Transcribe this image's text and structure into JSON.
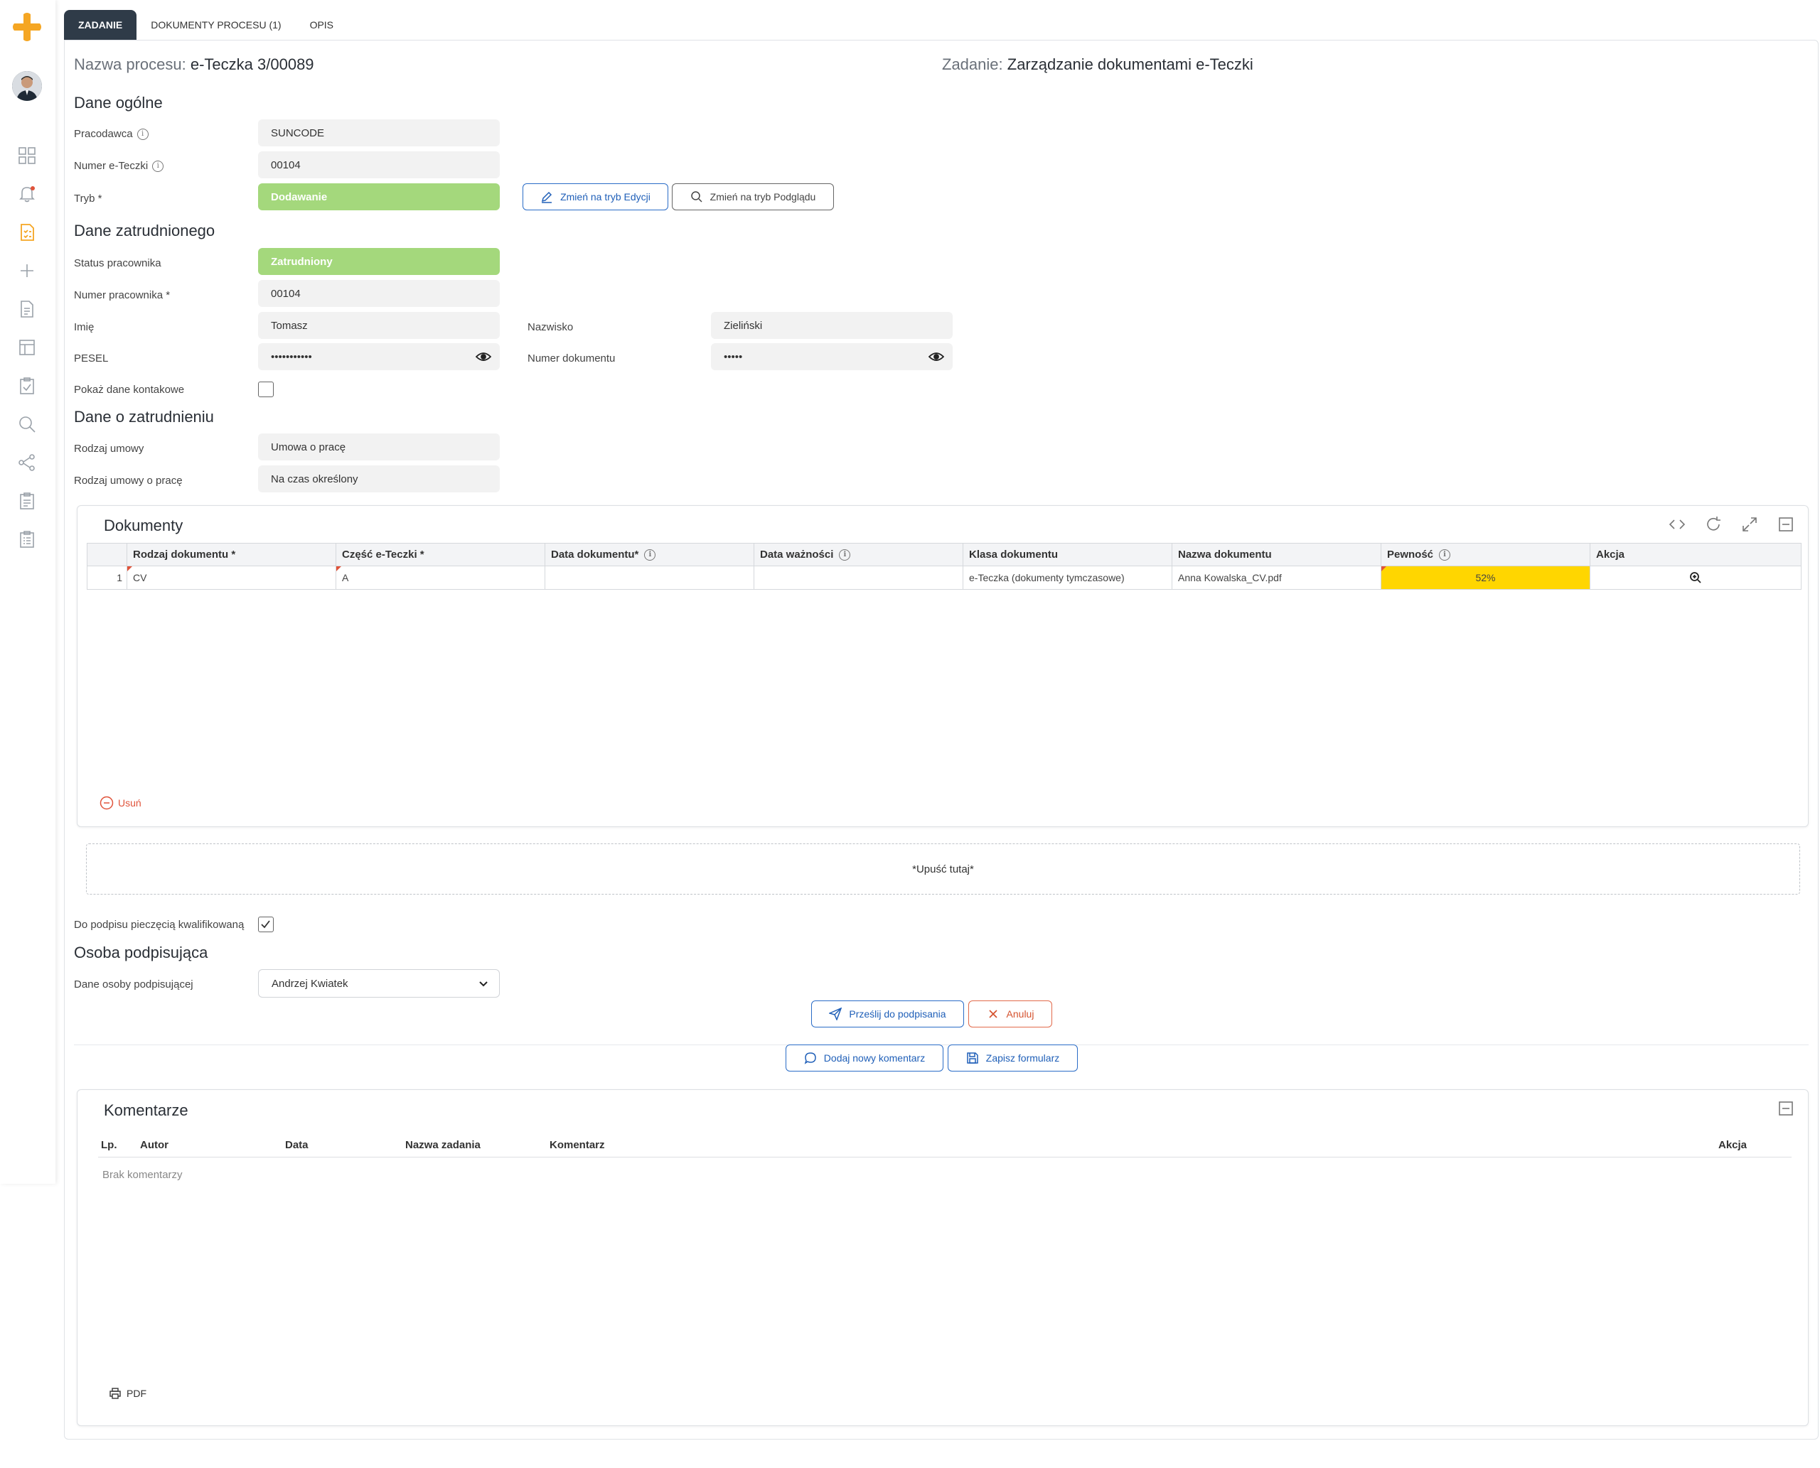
{
  "tabs": [
    {
      "label": "ZADANIE"
    },
    {
      "label": "DOKUMENTY PROCESU (1)"
    },
    {
      "label": "OPIS"
    }
  ],
  "header": {
    "process_label": "Nazwa procesu:",
    "process_value": "e-Teczka 3/00089",
    "task_label": "Zadanie:",
    "task_value": "Zarządzanie dokumentami e-Teczki"
  },
  "general": {
    "title": "Dane ogólne",
    "employer_label": "Pracodawca",
    "employer_value": "SUNCODE",
    "folder_label": "Numer e-Teczki",
    "folder_value": "00104",
    "mode_label": "Tryb *",
    "mode_value": "Dodawanie",
    "edit_button": "Zmień na tryb Edycji",
    "preview_button": "Zmień na tryb Podglądu"
  },
  "employee": {
    "title": "Dane zatrudnionego",
    "status_label": "Status pracownika",
    "status_value": "Zatrudniony",
    "number_label": "Numer pracownika *",
    "number_value": "00104",
    "first_name_label": "Imię",
    "first_name_value": "Tomasz",
    "last_name_label": "Nazwisko",
    "last_name_value": "Zieliński",
    "pesel_label": "PESEL",
    "pesel_value": "•••••••••••",
    "doc_number_label": "Numer dokumentu",
    "doc_number_value": "•••••",
    "show_contact_label": "Pokaż dane kontakowe"
  },
  "employment": {
    "title": "Dane o zatrudnieniu",
    "contract_type_label": "Rodzaj umowy",
    "contract_type_value": "Umowa o pracę",
    "work_contract_label": "Rodzaj umowy o pracę",
    "work_contract_value": "Na czas określony"
  },
  "documents": {
    "title": "Dokumenty",
    "columns": [
      "Rodzaj dokumentu *",
      "Część e-Teczki *",
      "Data dokumentu*",
      "Data ważności",
      "Klasa dokumentu",
      "Nazwa dokumentu",
      "Pewność",
      "Akcja"
    ],
    "rows": [
      {
        "num": "1",
        "type": "CV",
        "part": "A",
        "date": "",
        "expiry": "",
        "class": "e-Teczka (dokumenty tymczasowe)",
        "name": "Anna Kowalska_CV.pdf",
        "confidence": "52%"
      }
    ],
    "remove_label": "Usuń",
    "dropzone_label": "*Upuść tutaj*"
  },
  "signing": {
    "qualified_seal_label": "Do podpisu pieczęcią kwalifikowaną",
    "title": "Osoba podpisująca",
    "signer_label": "Dane osoby podpisującej",
    "signer_value": "Andrzej Kwiatek",
    "send_button": "Prześlij do podpisania",
    "cancel_button": "Anuluj",
    "add_comment_button": "Dodaj nowy komentarz",
    "save_button": "Zapisz formularz"
  },
  "comments": {
    "title": "Komentarze",
    "columns": [
      "Lp.",
      "Autor",
      "Data",
      "Nazwa zadania",
      "Komentarz",
      "Akcja"
    ],
    "empty": "Brak komentarzy",
    "pdf_label": "PDF"
  },
  "colors": {
    "accent_orange": "#f5a623",
    "green_field": "#a4d87c",
    "confidence_yellow": "#ffd600",
    "primary_blue": "#2a6cc7",
    "danger_red": "#e0533a"
  },
  "icons": {
    "sidebar": [
      "dashboard-icon",
      "bell-icon",
      "task-list-icon",
      "plus-icon",
      "document-icon",
      "table-icon",
      "checklist-icon",
      "search-icon",
      "share-icon",
      "clipboard-icon",
      "clipboard-list-icon"
    ]
  }
}
